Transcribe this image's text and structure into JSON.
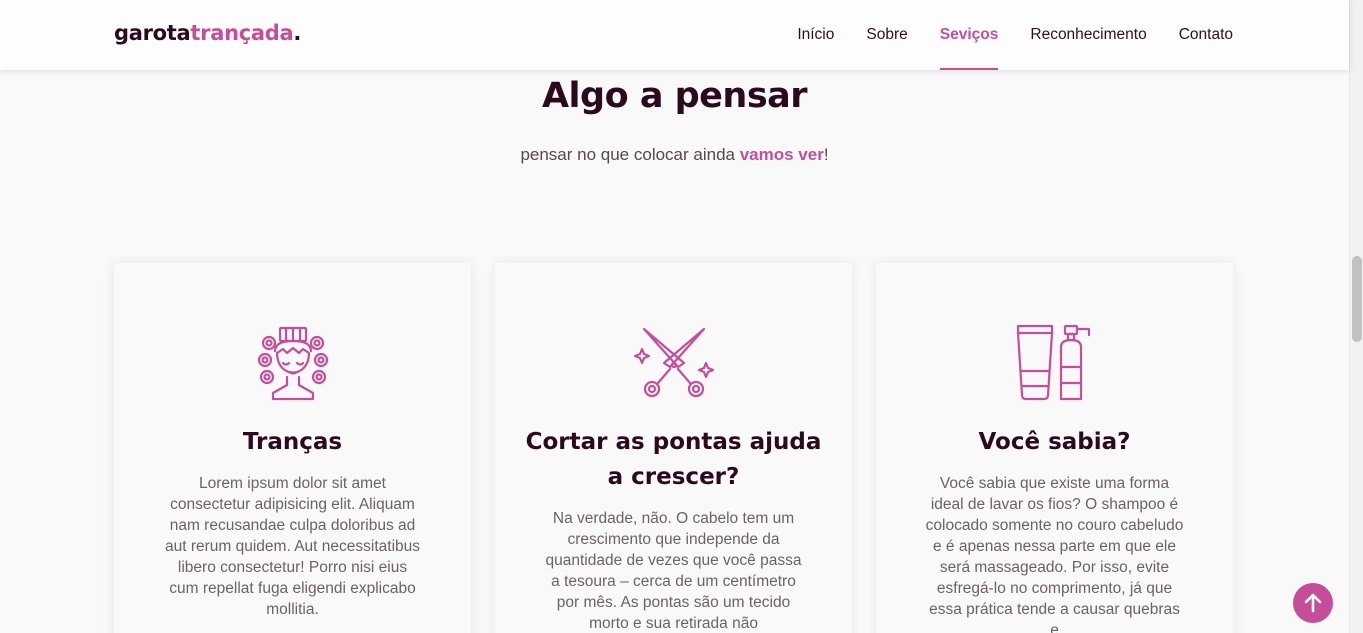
{
  "header": {
    "logo_main": "garota",
    "logo_accent": "trançada",
    "logo_dot": ".",
    "nav": [
      "Início",
      "Sobre",
      "Seviços",
      "Reconhecimento",
      "Contato"
    ],
    "active_nav": "Seviços"
  },
  "section": {
    "title": "Algo a pensar",
    "subtitle_pre": "pensar no que colocar ainda ",
    "subtitle_highlight": "vamos ver",
    "subtitle_post": "!"
  },
  "cards": [
    {
      "icon": "hair-rollers-icon",
      "title": "Tranças",
      "text": "Lorem ipsum dolor sit amet consectetur adipisicing elit. Aliquam nam recusandae culpa doloribus ad aut rerum quidem. Aut necessitatibus libero consectetur! Porro nisi eius cum repellat fuga eligendi explicabo mollitia."
    },
    {
      "icon": "scissors-icon",
      "title": "Cortar as pontas ajuda a crescer?",
      "text": "Na verdade, não. O cabelo tem um crescimento que independe da quantidade de vezes que você passa a tesoura – cerca de um centímetro por mês. As pontas são um tecido morto e sua retirada não"
    },
    {
      "icon": "shampoo-bottles-icon",
      "title": "Você sabia?",
      "text": "Você sabia que existe uma forma ideal de lavar os fios? O shampoo é colocado somente no couro cabeludo e é apenas nessa parte em que ele será massageado. Por isso, evite esfregá-lo no comprimento, já que essa prática tende a causar quebras e"
    }
  ],
  "scroll_top_icon": "arrow-up-icon",
  "colors": {
    "accent": "#c64e98",
    "dark": "#2a0a1c",
    "body_text": "#6b6268",
    "background": "#f9f9fa"
  }
}
